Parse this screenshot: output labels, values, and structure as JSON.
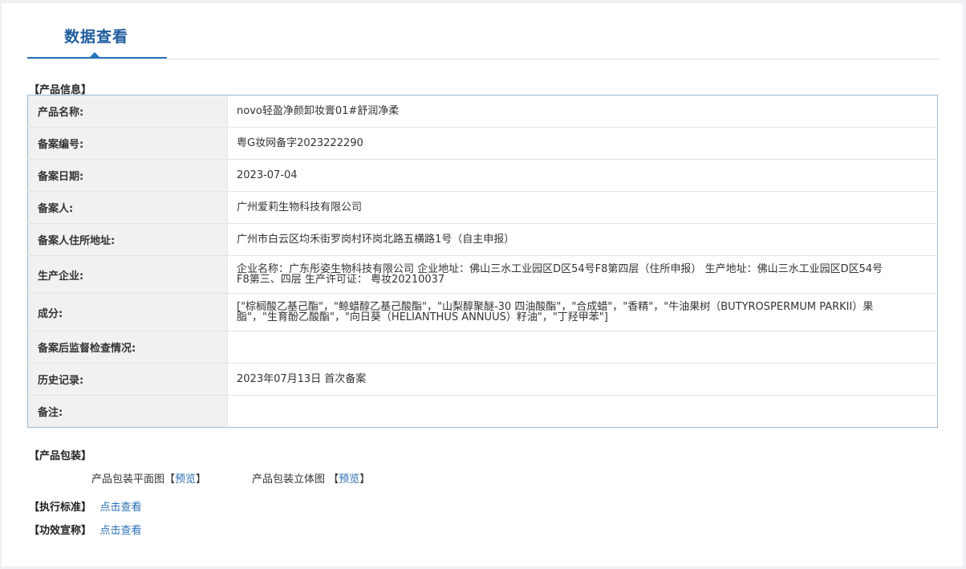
{
  "header": {
    "title": "数据查看"
  },
  "product_info": {
    "section_title": "【产品信息】",
    "rows": [
      {
        "label": "产品名称:",
        "value": "novo轻盈净颜卸妆膏01#舒润净柔"
      },
      {
        "label": "备案编号:",
        "value": "粤G妆网备字2023222290"
      },
      {
        "label": "备案日期:",
        "value": "2023-07-04"
      },
      {
        "label": "备案人:",
        "value": "广州爱莉生物科技有限公司"
      },
      {
        "label": "备案人住所地址:",
        "value": "广州市白云区均禾街罗岗村环岗北路五横路1号（自主申报）"
      },
      {
        "label": "生产企业:",
        "value": "企业名称：广东彤姿生物科技有限公司 企业地址：佛山三水工业园区D区54号F8第四层（住所申报） 生产地址：佛山三水工业园区D区54号F8第三、四层 生产许可证： 粤妆20210037"
      },
      {
        "label": "成分:",
        "value": "[\"棕榈酸乙基己酯\"，\"鲸蜡醇乙基己酸酯\"，\"山梨醇聚醚-30 四油酸酯\"，\"合成蜡\"，\"香精\"，\"牛油果树（BUTYROSPERMUM PARKII）果脂\"，\"生育酚乙酸酯\"，\"向日葵（HELIANTHUS ANNUUS）籽油\"，\"丁羟甲苯\"]"
      },
      {
        "label": "备案后监督检查情况:",
        "value": ""
      },
      {
        "label": "历史记录:",
        "value": "2023年07月13日 首次备案"
      },
      {
        "label": "备注:",
        "value": ""
      }
    ]
  },
  "packaging": {
    "section_title": "【产品包装】",
    "flat_label": "产品包装平面图",
    "solid_label": "产品包装立体图",
    "preview_text": "预览",
    "bracket_open": "【",
    "bracket_close": "】"
  },
  "standard": {
    "section_title": "【执行标准】",
    "link_text": "点击查看"
  },
  "efficacy": {
    "section_title": "【功效宣称】",
    "link_text": "点击查看"
  }
}
